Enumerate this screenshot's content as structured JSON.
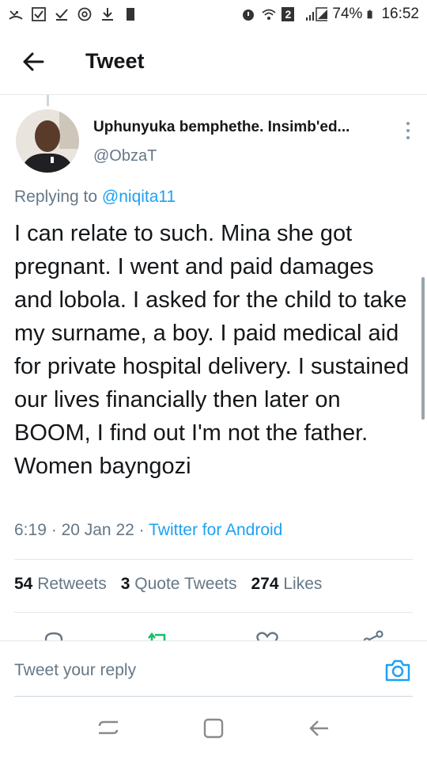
{
  "status_bar": {
    "battery": "74%",
    "time": "16:52",
    "sim_badge": "2",
    "left_icons": [
      "missed-call-icon",
      "checkbox-icon",
      "download-done-icon",
      "settings-icon",
      "download-icon",
      "sd-card-icon"
    ],
    "right_icons": [
      "alarm-icon",
      "wifi-icon",
      "signal-icon",
      "battery-icon"
    ]
  },
  "header": {
    "title": "Tweet",
    "back_icon": "arrow-left-icon"
  },
  "tweet": {
    "author_name": "Uphunyuka bemphethe. Insimb'ed...",
    "author_handle": "@ObzaT",
    "replying_prefix": "Replying to",
    "replying_to": "@niqita11",
    "text": "I can relate to such. Mina she got pregnant. I went and paid damages and lobola. I asked for the child to take my surname, a boy. I paid medical aid for private hospital delivery. I sustained our lives financially then later on BOOM, I find out I'm not the father. Women bayngozi",
    "time": "6:19",
    "date": "20 Jan 22",
    "separator": "·",
    "source": "Twitter for Android"
  },
  "stats": {
    "retweets_count": "54",
    "retweets_label": "Retweets",
    "quotes_count": "3",
    "quotes_label": "Quote Tweets",
    "likes_count": "274",
    "likes_label": "Likes"
  },
  "actions": [
    "reply-icon",
    "retweet-icon",
    "like-icon",
    "share-icon"
  ],
  "colors": {
    "accent": "#1da1f2",
    "retweet_green": "#17bf63",
    "muted": "#657786",
    "divider": "#e1e8ed"
  },
  "reply_bar": {
    "placeholder": "Tweet your reply"
  },
  "nav_bar": [
    "recents-icon",
    "home-icon",
    "back-icon"
  ]
}
